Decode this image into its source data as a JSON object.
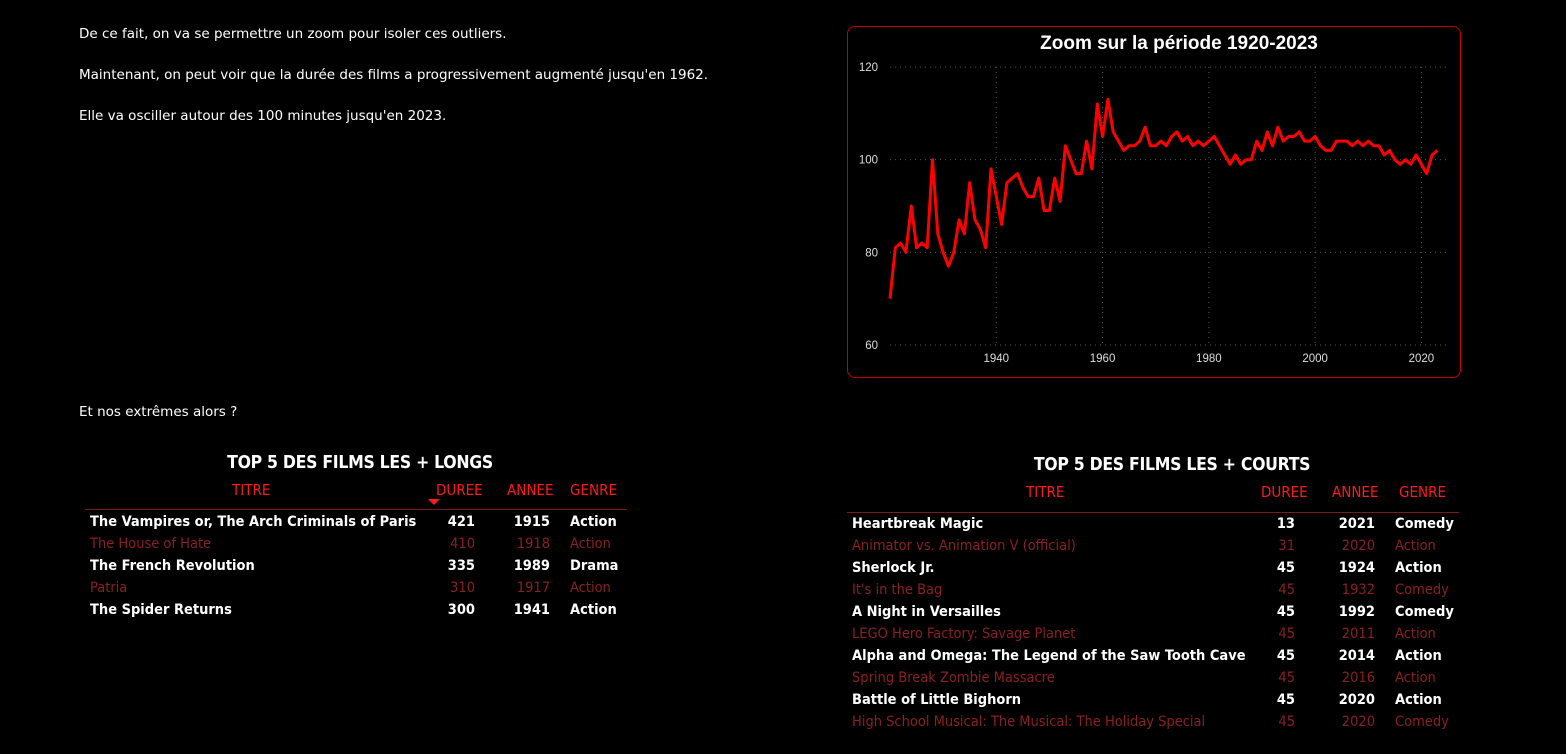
{
  "paragraphs": {
    "p1": "De ce fait, on va se permettre un zoom pour isoler ces outliers.",
    "p2": "Maintenant, on peut voir que la durée des films a progressivement augmenté jusqu'en 1962.",
    "p3": "Elle va osciller autour des 100 minutes jusqu'en 2023.",
    "p4": "Et nos extrêmes alors ?"
  },
  "chart_data": {
    "type": "line",
    "title": "Zoom sur la période 1920-2023",
    "xlabel": "",
    "ylabel": "",
    "xlim": [
      1920,
      2025
    ],
    "ylim": [
      60,
      120
    ],
    "xticks": [
      1940,
      1960,
      1980,
      2000,
      2020
    ],
    "yticks": [
      60,
      80,
      100,
      120
    ],
    "grid": true,
    "line_color": "#ff0000",
    "series": [
      {
        "name": "",
        "x": [
          1920,
          1921,
          1922,
          1923,
          1924,
          1925,
          1926,
          1927,
          1928,
          1929,
          1930,
          1931,
          1932,
          1933,
          1934,
          1935,
          1936,
          1937,
          1938,
          1939,
          1940,
          1941,
          1942,
          1943,
          1944,
          1945,
          1946,
          1947,
          1948,
          1949,
          1950,
          1951,
          1952,
          1953,
          1954,
          1955,
          1956,
          1957,
          1958,
          1959,
          1960,
          1961,
          1962,
          1963,
          1964,
          1965,
          1966,
          1967,
          1968,
          1969,
          1970,
          1971,
          1972,
          1973,
          1974,
          1975,
          1976,
          1977,
          1978,
          1979,
          1980,
          1981,
          1982,
          1983,
          1984,
          1985,
          1986,
          1987,
          1988,
          1989,
          1990,
          1991,
          1992,
          1993,
          1994,
          1995,
          1996,
          1997,
          1998,
          1999,
          2000,
          2001,
          2002,
          2003,
          2004,
          2005,
          2006,
          2007,
          2008,
          2009,
          2010,
          2011,
          2012,
          2013,
          2014,
          2015,
          2016,
          2017,
          2018,
          2019,
          2020,
          2021,
          2022,
          2023
        ],
        "values": [
          70,
          81,
          82,
          80,
          90,
          81,
          82,
          81,
          100,
          84,
          80,
          77,
          80,
          87,
          84,
          95,
          87,
          85,
          81,
          98,
          92,
          86,
          95,
          96,
          97,
          94,
          92,
          92,
          96,
          89,
          89,
          96,
          91,
          103,
          100,
          97,
          97,
          104,
          98,
          112,
          105,
          113,
          106,
          104,
          102,
          103,
          103,
          104,
          107,
          103,
          103,
          104,
          103,
          105,
          106,
          104,
          105,
          103,
          104,
          103,
          104,
          105,
          103,
          101,
          99,
          101,
          99,
          100,
          100,
          104,
          102,
          106,
          103,
          107,
          104,
          105,
          105,
          106,
          104,
          104,
          105,
          103,
          102,
          102,
          104,
          104,
          104,
          103,
          104,
          103,
          104,
          103,
          103,
          101,
          102,
          100,
          99,
          100,
          99,
          101,
          99,
          97,
          101,
          102
        ]
      }
    ]
  },
  "top_long": {
    "title": "TOP 5 DES FILMS LES + LONGS",
    "headers": {
      "titre": "TITRE",
      "duree": "DUREE",
      "annee": "ANNEE",
      "genre": "GENRE"
    },
    "rows": [
      {
        "titre": "The Vampires or, The Arch Criminals of Paris",
        "duree": "421",
        "annee": "1915",
        "genre": "Action"
      },
      {
        "titre": "The House of Hate",
        "duree": "410",
        "annee": "1918",
        "genre": "Action"
      },
      {
        "titre": "The French Revolution",
        "duree": "335",
        "annee": "1989",
        "genre": "Drama"
      },
      {
        "titre": "Patria",
        "duree": "310",
        "annee": "1917",
        "genre": "Action"
      },
      {
        "titre": "The Spider Returns",
        "duree": "300",
        "annee": "1941",
        "genre": "Action"
      }
    ]
  },
  "top_short": {
    "title": "TOP 5 DES FILMS LES + COURTS",
    "headers": {
      "titre": "TITRE",
      "duree": "DUREE",
      "annee": "ANNEE",
      "genre": "GENRE"
    },
    "rows": [
      {
        "titre": "Heartbreak Magic",
        "duree": "13",
        "annee": "2021",
        "genre": "Comedy"
      },
      {
        "titre": "Animator vs. Animation V (official)",
        "duree": "31",
        "annee": "2020",
        "genre": "Action"
      },
      {
        "titre": "Sherlock Jr.",
        "duree": "45",
        "annee": "1924",
        "genre": "Action"
      },
      {
        "titre": "It's in the Bag",
        "duree": "45",
        "annee": "1932",
        "genre": "Comedy"
      },
      {
        "titre": "A Night in Versailles",
        "duree": "45",
        "annee": "1992",
        "genre": "Comedy"
      },
      {
        "titre": "LEGO Hero Factory: Savage Planet",
        "duree": "45",
        "annee": "2011",
        "genre": "Action"
      },
      {
        "titre": "Alpha and Omega: The Legend of the Saw Tooth Cave",
        "duree": "45",
        "annee": "2014",
        "genre": "Action"
      },
      {
        "titre": "Spring Break Zombie Massacre",
        "duree": "45",
        "annee": "2016",
        "genre": "Action"
      },
      {
        "titre": "Battle of Little Bighorn",
        "duree": "45",
        "annee": "2020",
        "genre": "Action"
      },
      {
        "titre": "High School Musical: The Musical: The Holiday Special",
        "duree": "45",
        "annee": "2020",
        "genre": "Comedy"
      }
    ]
  }
}
